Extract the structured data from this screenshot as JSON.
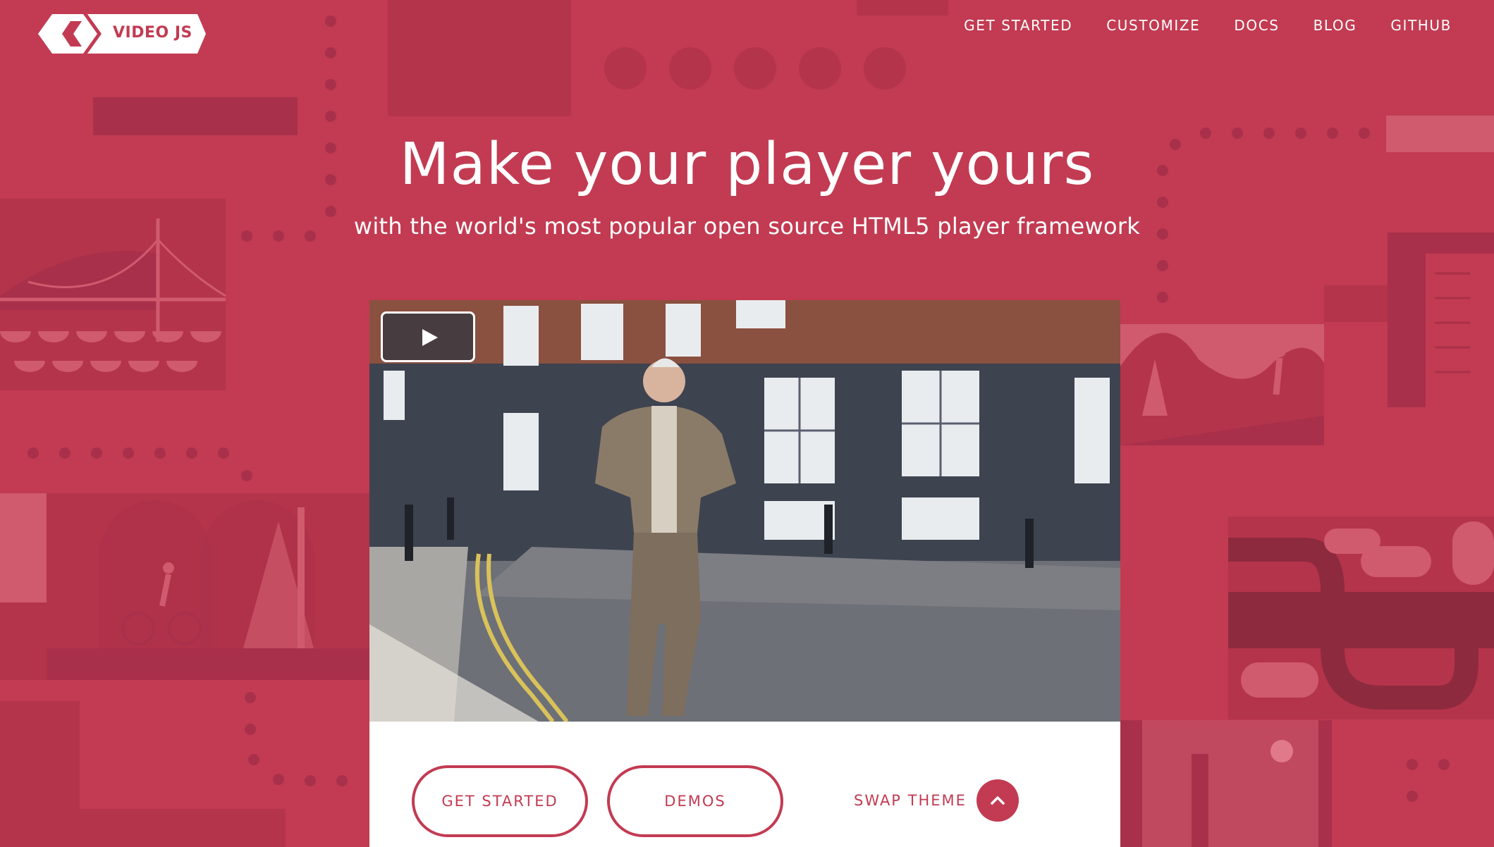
{
  "header": {
    "logo_text": "VIDEO JS",
    "nav": [
      "GET STARTED",
      "CUSTOMIZE",
      "DOCS",
      "BLOG",
      "GITHUB"
    ]
  },
  "hero": {
    "title": "Make your player yours",
    "subtitle": "with the world's most popular open source HTML5 player framework"
  },
  "player": {
    "play_icon": "play-icon"
  },
  "actions": {
    "get_started": "GET STARTED",
    "demos": "DEMOS",
    "swap_theme": "SWAP THEME",
    "swap_icon": "chevron-up-icon"
  },
  "colors": {
    "brand": "#c23b52",
    "brand_dark": "#a9304a",
    "brand_light": "#d05a6e"
  }
}
